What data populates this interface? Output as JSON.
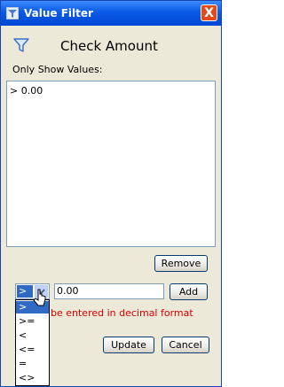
{
  "window": {
    "title": "Value Filter",
    "close_label": "X",
    "title_bar_color": "#0a5ae6"
  },
  "header": {
    "heading": "Check Amount",
    "icon": "funnel-icon"
  },
  "list": {
    "label": "Only Show Values:",
    "items": [
      "> 0.00"
    ]
  },
  "buttons": {
    "remove": "Remove",
    "add": "Add",
    "update": "Update",
    "cancel": "Cancel"
  },
  "operator_select": {
    "value": ">",
    "options": [
      ">",
      ">=",
      "<",
      "<=",
      "=",
      "<>"
    ],
    "selected_index": 0,
    "highlight_color": "#316ac5"
  },
  "value_input": {
    "value": "0.00"
  },
  "validation": {
    "message": "be entered in decimal format",
    "color": "#d40000"
  }
}
